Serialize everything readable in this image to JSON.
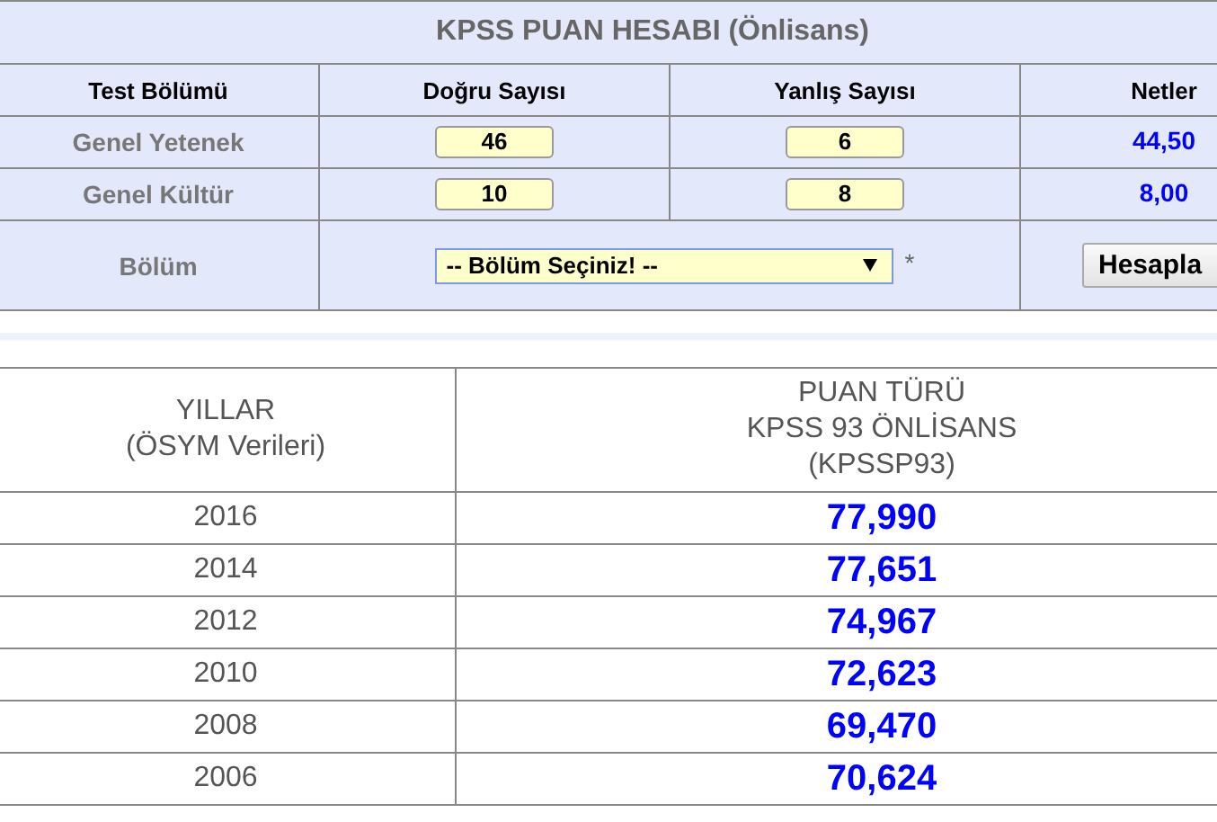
{
  "title": "KPSS PUAN HESABI (Önlisans)",
  "columns": [
    "Test Bölümü",
    "Doğru Sayısı",
    "Yanlış Sayısı",
    "Netler"
  ],
  "tests": [
    {
      "name": "Genel Yetenek",
      "correct": "46",
      "wrong": "6",
      "net": "44,50"
    },
    {
      "name": "Genel Kültür",
      "correct": "10",
      "wrong": "8",
      "net": "8,00"
    }
  ],
  "section": {
    "label": "Bölüm",
    "value": "-- Bölüm Seçiniz! --",
    "required_mark": "*"
  },
  "button": "Hesapla",
  "scores": {
    "columns": [
      [
        "YILLAR",
        "(ÖSYM Verileri)"
      ],
      [
        "PUAN TÜRÜ",
        "KPSS 93 ÖNLİSANS",
        "(KPSSP93)"
      ]
    ],
    "rows": [
      {
        "year": "2016",
        "score": "77,990"
      },
      {
        "year": "2014",
        "score": "77,651"
      },
      {
        "year": "2012",
        "score": "74,967"
      },
      {
        "year": "2010",
        "score": "72,623"
      },
      {
        "year": "2008",
        "score": "69,470"
      },
      {
        "year": "2006",
        "score": "70,624"
      }
    ]
  }
}
